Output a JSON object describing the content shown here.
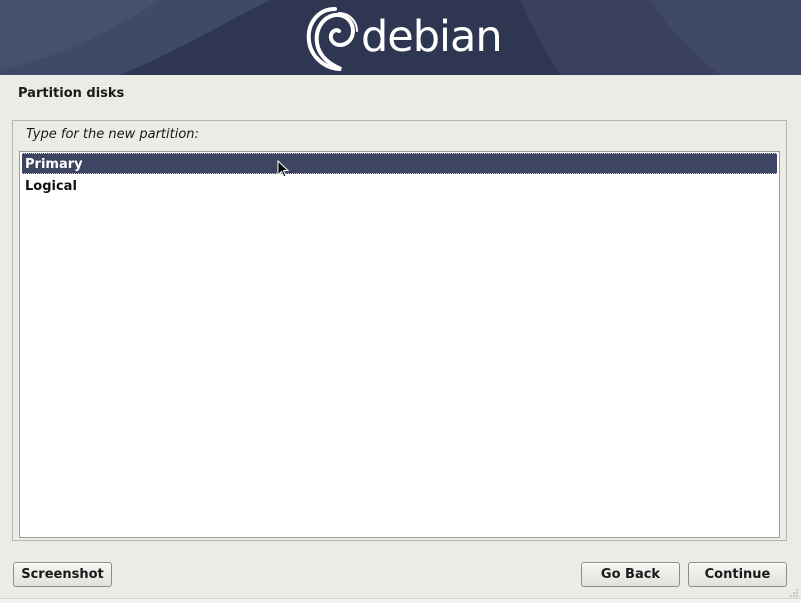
{
  "banner": {
    "logo_text": "debian",
    "background_color": "#2f3652"
  },
  "page": {
    "title": "Partition disks",
    "prompt": "Type for the new partition:"
  },
  "options": {
    "items": [
      {
        "label": "Primary",
        "selected": true
      },
      {
        "label": "Logical",
        "selected": false
      }
    ]
  },
  "buttons": {
    "screenshot": "Screenshot",
    "go_back": "Go Back",
    "continue": "Continue"
  },
  "colors": {
    "selection": "#3e4563",
    "window_bg": "#ecebe6"
  }
}
